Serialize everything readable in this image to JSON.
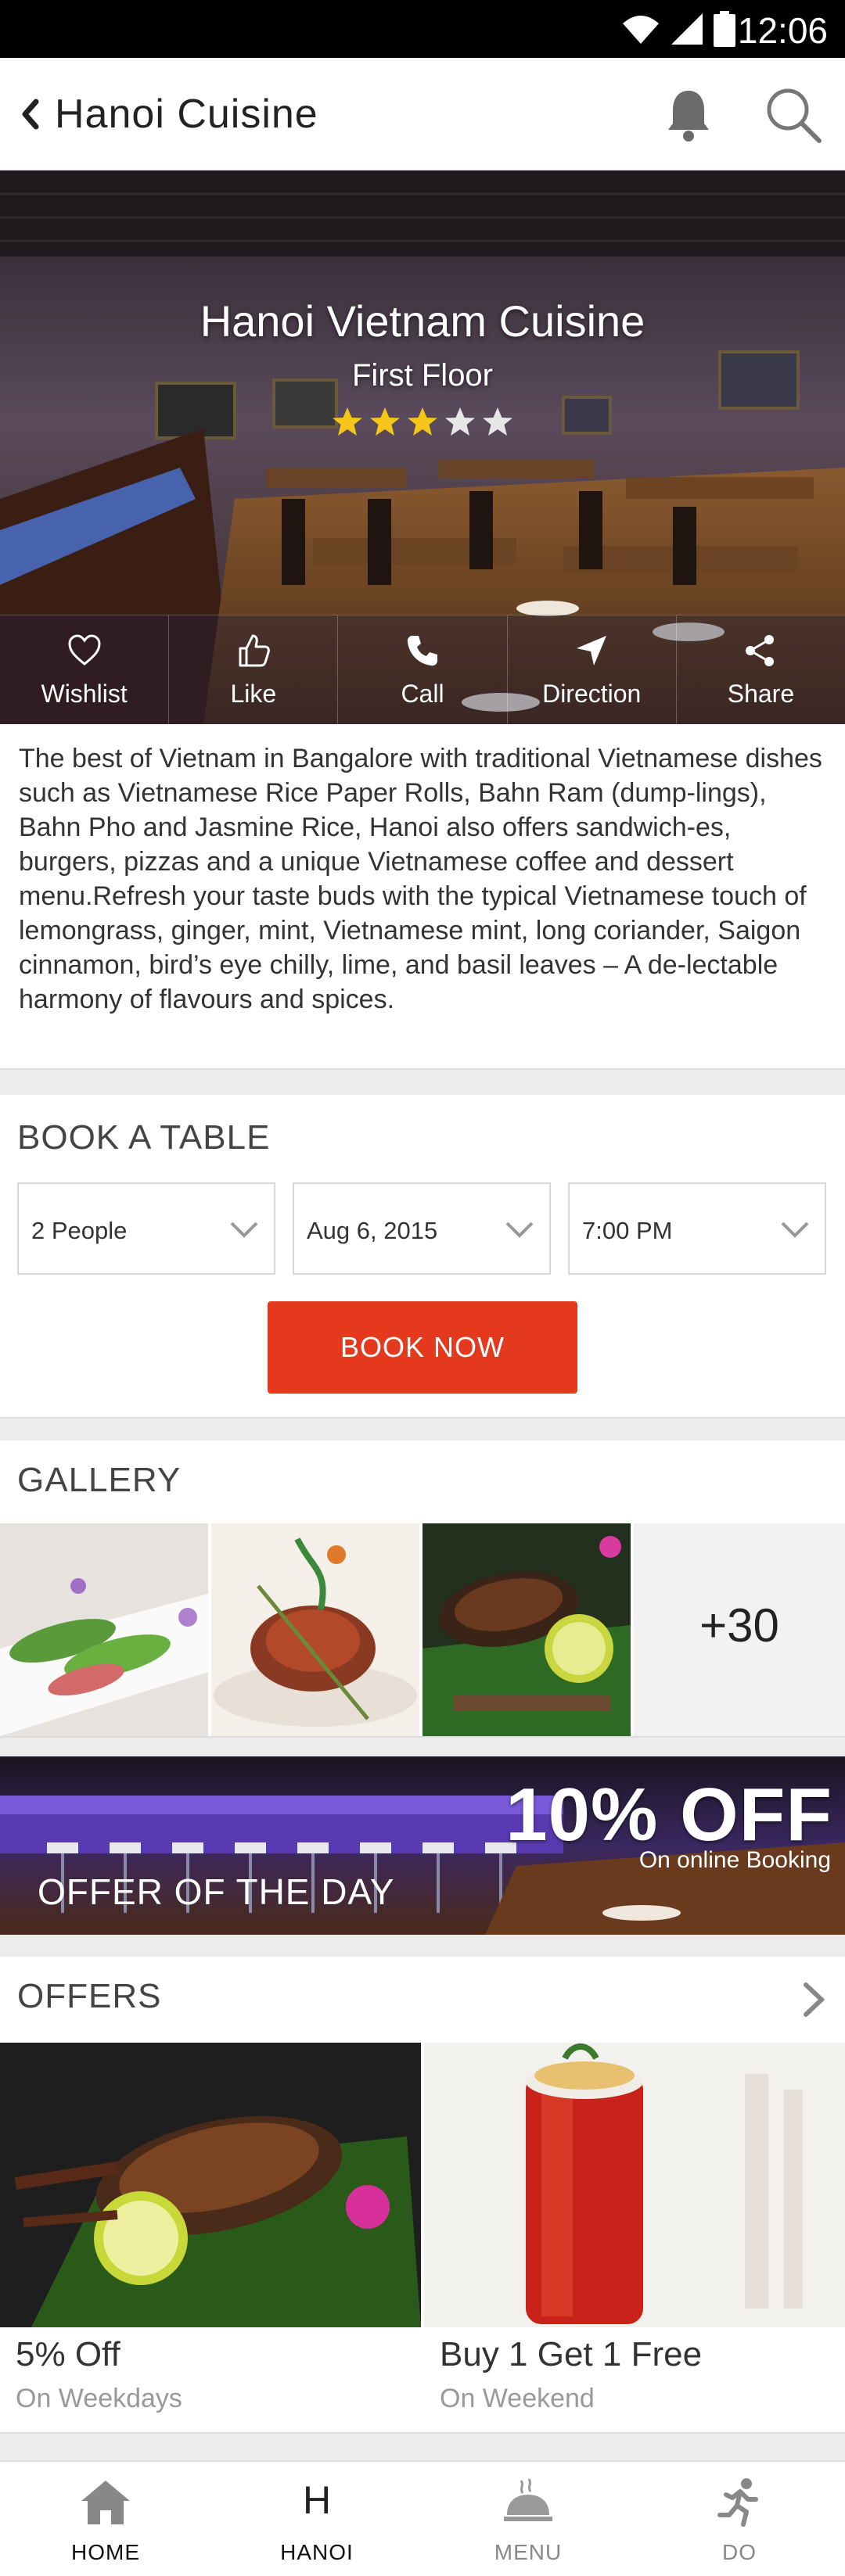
{
  "status_bar": {
    "time": "12:06"
  },
  "app_bar": {
    "title": "Hanoi Cuisine"
  },
  "hero": {
    "name": "Hanoi Vietnam Cuisine",
    "subtitle": "First Floor",
    "rating": 3,
    "rating_max": 5,
    "actions": [
      {
        "label": "Wishlist",
        "icon": "heart-icon"
      },
      {
        "label": "Like",
        "icon": "thumbs-up-icon"
      },
      {
        "label": "Call",
        "icon": "phone-icon"
      },
      {
        "label": "Direction",
        "icon": "navigation-arrow-icon"
      },
      {
        "label": "Share",
        "icon": "share-icon"
      }
    ]
  },
  "description": "The best of Vietnam in Bangalore with traditional Vietnamese dishes such as Vietnamese Rice Paper Rolls, Bahn Ram (dump-lings), Bahn Pho and Jasmine Rice, Hanoi also offers sandwich-es, burgers, pizzas and a unique Vietnamese coffee and dessert menu.Refresh your taste buds with the typical Vietnamese touch of lemongrass, ginger, mint, Vietnamese mint, long coriander, Saigon cinnamon, bird’s eye chilly, lime, and basil leaves – A de-lectable harmony of flavours and spices.",
  "booking": {
    "title": "BOOK A TABLE",
    "people": "2 People",
    "date": "Aug 6, 2015",
    "time": "7:00 PM",
    "button": "BOOK NOW"
  },
  "gallery": {
    "title": "GALLERY",
    "more": "+30"
  },
  "offer_of_day": {
    "discount": "10% OFF",
    "note": "On online Booking",
    "label": "OFFER OF THE DAY"
  },
  "offers": {
    "title": "OFFERS",
    "items": [
      {
        "title": "5% Off",
        "subtitle": "On Weekdays"
      },
      {
        "title": "Buy 1 Get 1 Free",
        "subtitle": "On Weekend"
      }
    ]
  },
  "bottom_nav": [
    {
      "label": "HOME",
      "icon": "home-icon",
      "active": true
    },
    {
      "label": "HANOI",
      "letter": "H",
      "active": true
    },
    {
      "label": "MENU",
      "icon": "cloche-icon",
      "active": false
    },
    {
      "label": "DO",
      "icon": "running-person-icon",
      "active": false
    }
  ],
  "colors": {
    "accent": "#e4391d",
    "star": "#f5c518"
  }
}
